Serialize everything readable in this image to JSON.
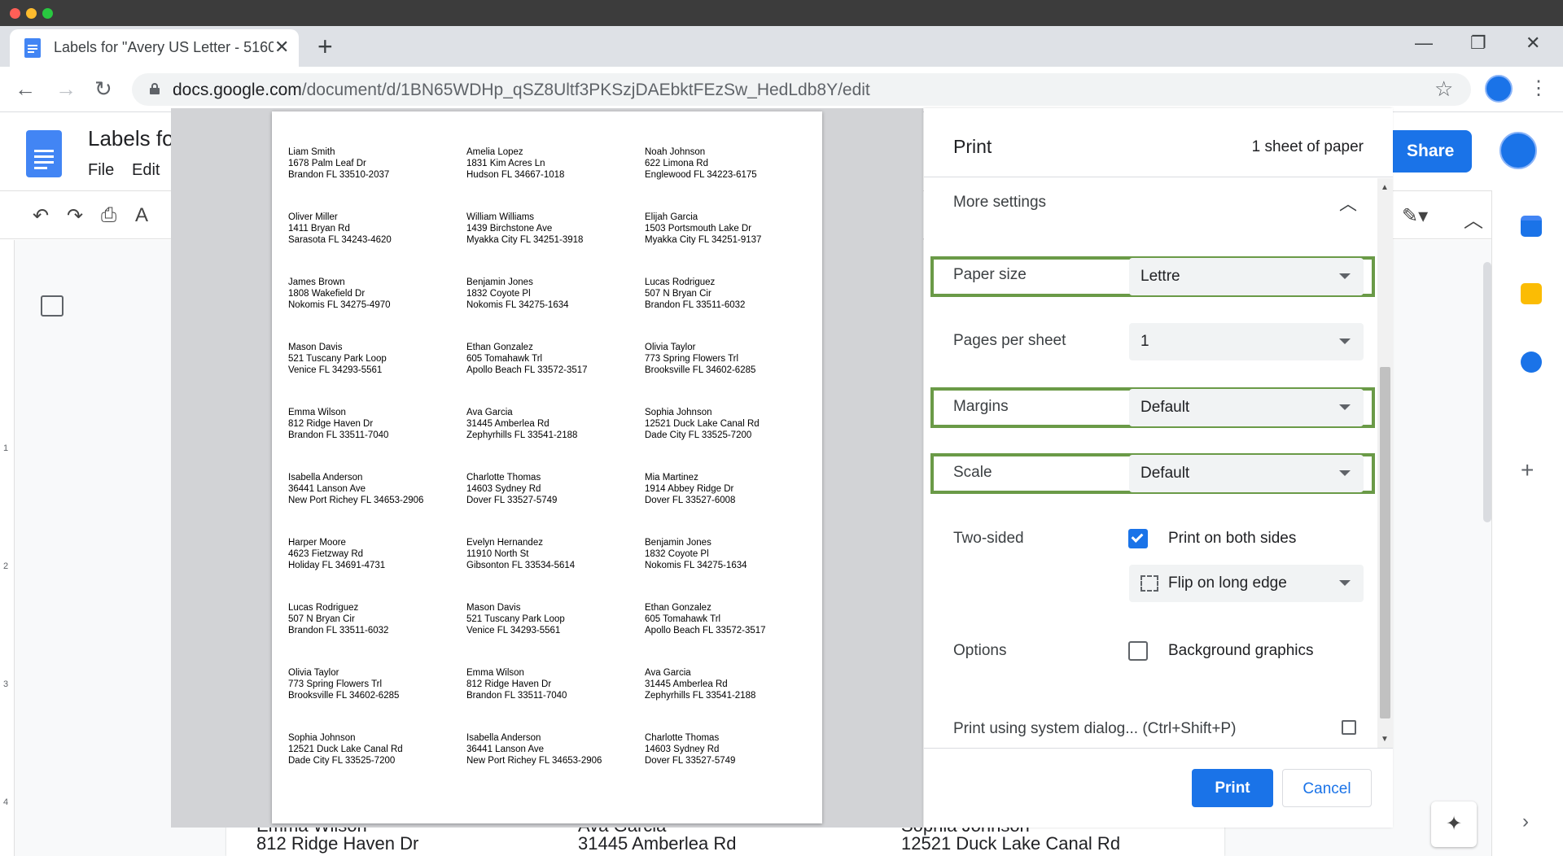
{
  "browser": {
    "tab_title": "Labels for \"Avery US Letter - 5160",
    "new_tab_icon": "+",
    "url_domain": "docs.google.com",
    "url_path": "/document/d/1BN65WDHp_qSZ8Ultf3PKSzjDAEbktFEzSw_HedLdb8Y/edit"
  },
  "docs": {
    "title": "Labels fo",
    "menu": [
      "File",
      "Edit"
    ],
    "share_label": "Share",
    "ruler_numbers": [
      "1",
      "2",
      "3",
      "4"
    ]
  },
  "behind_text": [
    {
      "name": "Emma Wilson",
      "street": "812 Ridge Haven Dr"
    },
    {
      "name": "Ava Garcia",
      "street": "31445 Amberlea Rd"
    },
    {
      "name": "Sophia Johnson",
      "street": "12521 Duck Lake Canal Rd"
    }
  ],
  "labels": [
    [
      "Liam Smith",
      "1678 Palm Leaf Dr",
      "Brandon FL 33510-2037"
    ],
    [
      "Amelia Lopez",
      "1831 Kim Acres Ln",
      "Hudson FL 34667-1018"
    ],
    [
      "Noah Johnson",
      "622 Limona Rd",
      "Englewood FL 34223-6175"
    ],
    [
      "Oliver Miller",
      "1411 Bryan Rd",
      "Sarasota FL 34243-4620"
    ],
    [
      "William Williams",
      "1439 Birchstone Ave",
      "Myakka City FL 34251-3918"
    ],
    [
      "Elijah Garcia",
      "1503 Portsmouth Lake Dr",
      "Myakka City FL 34251-9137"
    ],
    [
      "James Brown",
      "1808 Wakefield Dr",
      "Nokomis FL 34275-4970"
    ],
    [
      "Benjamin Jones",
      "1832 Coyote Pl",
      "Nokomis FL 34275-1634"
    ],
    [
      "Lucas Rodriguez",
      "507 N Bryan Cir",
      "Brandon FL 33511-6032"
    ],
    [
      "Mason Davis",
      "521 Tuscany Park Loop",
      "Venice FL 34293-5561"
    ],
    [
      "Ethan Gonzalez",
      "605 Tomahawk Trl",
      "Apollo Beach FL 33572-3517"
    ],
    [
      "Olivia Taylor",
      "773 Spring Flowers Trl",
      "Brooksville FL 34602-6285"
    ],
    [
      "Emma Wilson",
      "812 Ridge Haven Dr",
      "Brandon FL 33511-7040"
    ],
    [
      "Ava Garcia",
      "31445 Amberlea Rd",
      "Zephyrhills FL 33541-2188"
    ],
    [
      "Sophia Johnson",
      "12521 Duck Lake Canal Rd",
      "Dade City FL 33525-7200"
    ],
    [
      "Isabella Anderson",
      "36441 Lanson Ave",
      "New Port Richey FL 34653-2906"
    ],
    [
      "Charlotte Thomas",
      "14603 Sydney Rd",
      "Dover FL 33527-5749"
    ],
    [
      "Mia Martinez",
      "1914 Abbey Ridge Dr",
      "Dover FL 33527-6008"
    ],
    [
      "Harper Moore",
      "4623 Fietzway Rd",
      "Holiday FL 34691-4731"
    ],
    [
      "Evelyn Hernandez",
      "11910 North St",
      "Gibsonton FL 33534-5614"
    ],
    [
      "Benjamin Jones",
      "1832 Coyote Pl",
      "Nokomis FL 34275-1634"
    ],
    [
      "Lucas Rodriguez",
      "507 N Bryan Cir",
      "Brandon FL 33511-6032"
    ],
    [
      "Mason Davis",
      "521 Tuscany Park Loop",
      "Venice FL 34293-5561"
    ],
    [
      "Ethan Gonzalez",
      "605 Tomahawk Trl",
      "Apollo Beach FL 33572-3517"
    ],
    [
      "Olivia Taylor",
      "773 Spring Flowers Trl",
      "Brooksville FL 34602-6285"
    ],
    [
      "Emma Wilson",
      "812 Ridge Haven Dr",
      "Brandon FL 33511-7040"
    ],
    [
      "Ava Garcia",
      "31445 Amberlea Rd",
      "Zephyrhills FL 33541-2188"
    ],
    [
      "Sophia Johnson",
      "12521 Duck Lake Canal Rd",
      "Dade City FL 33525-7200"
    ],
    [
      "Isabella Anderson",
      "36441 Lanson Ave",
      "New Port Richey FL 34653-2906"
    ],
    [
      "Charlotte Thomas",
      "14603 Sydney Rd",
      "Dover FL 33527-5749"
    ]
  ],
  "print": {
    "title": "Print",
    "sheets": "1 sheet of paper",
    "more_settings": "More settings",
    "paper_size_label": "Paper size",
    "paper_size_value": "Lettre",
    "pages_per_sheet_label": "Pages per sheet",
    "pages_per_sheet_value": "1",
    "margins_label": "Margins",
    "margins_value": "Default",
    "scale_label": "Scale",
    "scale_value": "Default",
    "two_sided_label": "Two-sided",
    "print_both_sides": "Print on both sides",
    "print_both_sides_checked": true,
    "flip_value": "Flip on long edge",
    "options_label": "Options",
    "background_graphics": "Background graphics",
    "background_graphics_checked": false,
    "system_dialog": "Print using system dialog... (Ctrl+Shift+P)",
    "print_button": "Print",
    "cancel_button": "Cancel"
  },
  "colors": {
    "accent": "#1a73e8",
    "highlight_border": "#6a9a47"
  }
}
